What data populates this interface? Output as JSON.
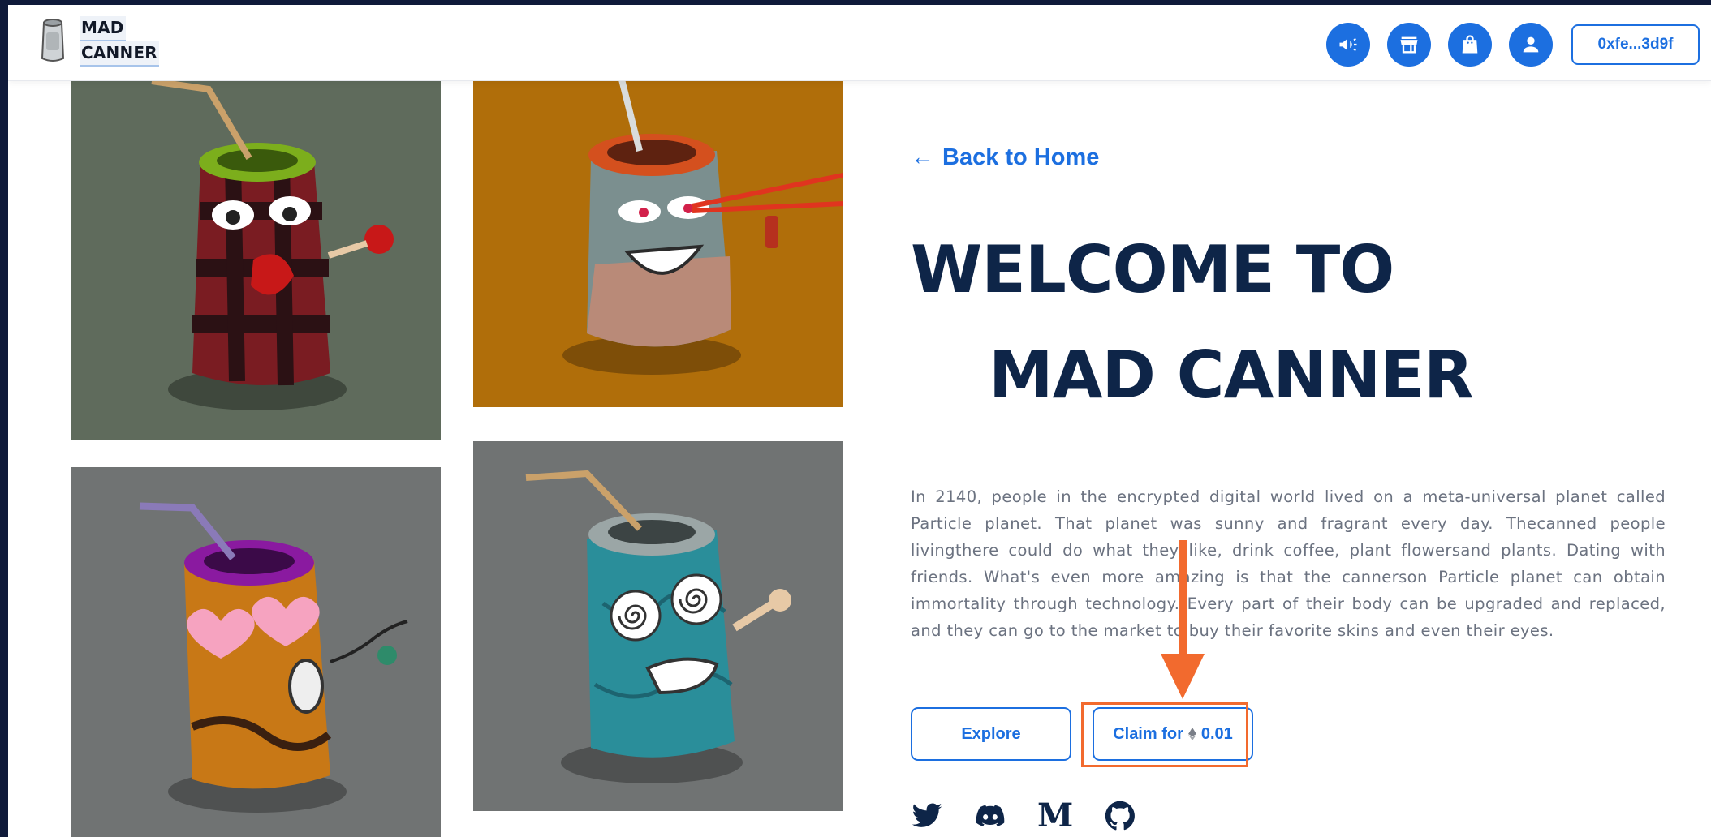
{
  "header": {
    "logo_line1": "MAD",
    "logo_line2": "CANNER",
    "nav": [
      "megaphone-icon",
      "store-icon",
      "shopping-bag-icon",
      "user-icon"
    ],
    "wallet_label": "0xfe...3d9f"
  },
  "gallery": {
    "tiles": [
      {
        "name": "red-plaid-can",
        "bg": "#5f6b5c"
      },
      {
        "name": "laser-eyes-can",
        "bg": "#b06e0a"
      },
      {
        "name": "heart-eyes-can",
        "bg": "#707373"
      },
      {
        "name": "spiral-eyes-can",
        "bg": "#707373"
      }
    ]
  },
  "main": {
    "back_link": "Back to Home",
    "title_line1": "WELCOME TO",
    "title_line2": "MAD CANNER",
    "description": "In 2140, people in the encrypted digital world lived on a meta-universal planet called Particle planet. That planet was sunny and fragrant every day. Thecanned people livingthere could do what they like, drink coffee, plant flowersand plants. Dating with friends. What's even more amazing is that the cannerson Particle planet can obtain immortality through technology. Every part of their body can be upgraded and replaced, and they can go to the market to buy their favorite skins and even their eyes.",
    "explore_label": "Explore",
    "claim_prefix": "Claim for",
    "claim_amount": "0.01",
    "socials": [
      "twitter-icon",
      "discord-icon",
      "medium-icon",
      "github-icon"
    ],
    "medium_letter": "M"
  },
  "colors": {
    "accent": "#1c6fe0",
    "title": "#0e2548",
    "highlight": "#f26a2e"
  }
}
